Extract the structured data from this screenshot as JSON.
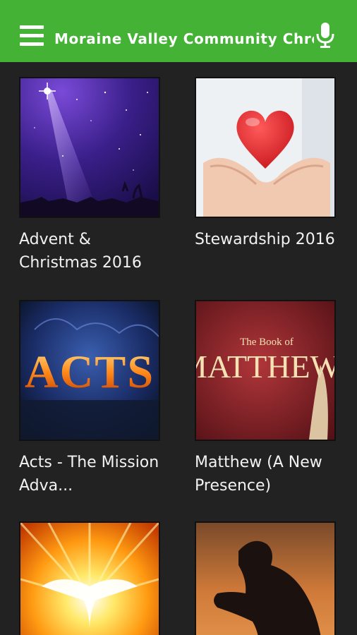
{
  "app": {
    "title": "Moraine Valley Community Chrch",
    "menu_icon": "hamburger-menu-icon",
    "voice_icon": "microphone-icon",
    "accent_color": "#44b335"
  },
  "series": [
    {
      "caption": "Advent & Christmas 2016",
      "image": "starry-night-bethlehem"
    },
    {
      "caption": "Stewardship 2016",
      "image": "hands-holding-heart"
    },
    {
      "caption": "Acts - The Mission Adva...",
      "image": "acts-fire-title",
      "image_text": "ACTS"
    },
    {
      "caption": "Matthew (A New Presence)",
      "image": "book-of-matthew-title",
      "image_text_top": "The Book of",
      "image_text_main": "MATTHEW"
    },
    {
      "caption": "",
      "image": "dove-radiant-light"
    },
    {
      "caption": "",
      "image": "silhouette-praying-man"
    }
  ]
}
